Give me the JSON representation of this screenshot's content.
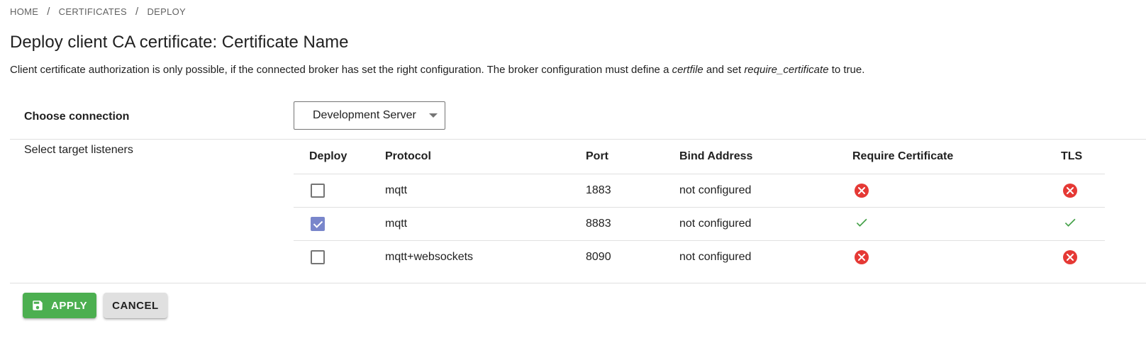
{
  "breadcrumb": {
    "items": [
      "HOME",
      "CERTIFICATES",
      "DEPLOY"
    ],
    "separator": "/"
  },
  "page": {
    "title": "Deploy client CA certificate: Certificate Name",
    "description_parts": {
      "p1": "Client certificate authorization is only possible, if the connected broker has set the right configuration. The broker configuration must define a ",
      "em1": "certfile",
      "p2": " and set ",
      "em2": "require_certificate",
      "p3": " to true."
    }
  },
  "connection": {
    "label": "Choose connection",
    "selected": "Development Server"
  },
  "listeners": {
    "label": "Select target listeners",
    "columns": [
      "Deploy",
      "Protocol",
      "Port",
      "Bind Address",
      "Require Certificate",
      "TLS"
    ],
    "rows": [
      {
        "deploy": false,
        "protocol": "mqtt",
        "port": "1883",
        "bind_address": "not configured",
        "require_certificate": false,
        "tls": false
      },
      {
        "deploy": true,
        "protocol": "mqtt",
        "port": "8883",
        "bind_address": "not configured",
        "require_certificate": true,
        "tls": true
      },
      {
        "deploy": false,
        "protocol": "mqtt+websockets",
        "port": "8090",
        "bind_address": "not configured",
        "require_certificate": false,
        "tls": false
      }
    ]
  },
  "actions": {
    "apply_label": "APPLY",
    "apply_icon": "save-icon",
    "cancel_label": "CANCEL"
  },
  "colors": {
    "apply": "#4caf50",
    "checkbox_checked": "#7986cb",
    "error": "#e53935",
    "success": "#43a047"
  }
}
